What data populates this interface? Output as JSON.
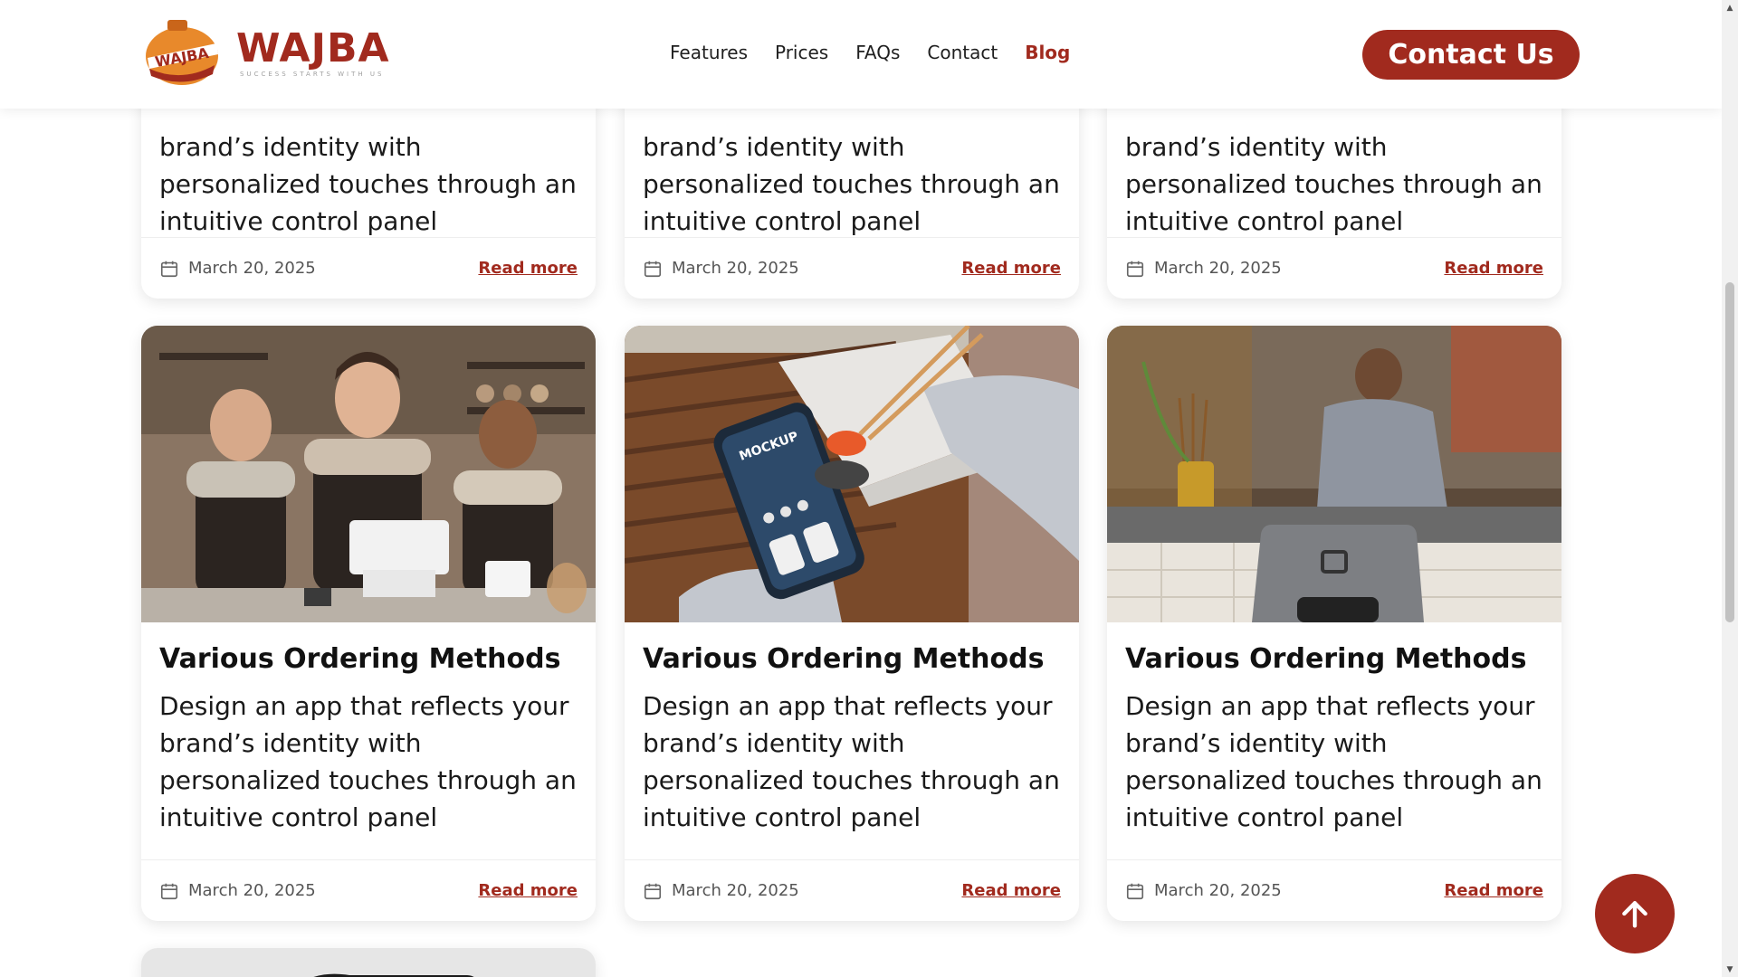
{
  "header": {
    "logo_badge_text": "WAJBA",
    "logo_word": "WAJBA",
    "logo_tagline": "SUCCESS STARTS WITH US",
    "nav": [
      {
        "label": "Features",
        "active": false
      },
      {
        "label": "Prices",
        "active": false
      },
      {
        "label": "FAQs",
        "active": false
      },
      {
        "label": "Contact",
        "active": false
      },
      {
        "label": "Blog",
        "active": true
      }
    ],
    "contact_button": "Contact Us"
  },
  "colors": {
    "brand": "#a12a1e",
    "accent_orange": "#e8892b"
  },
  "top_cards": [
    {
      "desc_line1": "brand’s identity with",
      "desc_line2": "personalized touches through an",
      "desc_line3": "intuitive control panel",
      "date": "March 20, 2025",
      "read_more": "Read more"
    },
    {
      "desc_line1": "brand’s identity with",
      "desc_line2": "personalized touches through an",
      "desc_line3": "intuitive control panel",
      "date": "March 20, 2025",
      "read_more": "Read more"
    },
    {
      "desc_line1": "brand’s identity with",
      "desc_line2": "personalized touches through an",
      "desc_line3": "intuitive control panel",
      "date": "March 20, 2025",
      "read_more": "Read more"
    }
  ],
  "cards": [
    {
      "image": "baristas-at-counter",
      "title": "Various Ordering Methods",
      "desc_line1": "Design an app that reflects your",
      "desc_line2": "brand’s identity with",
      "desc_line3": "personalized touches through an",
      "desc_line4": "intuitive control panel",
      "date": "March 20, 2025",
      "read_more": "Read more"
    },
    {
      "image": "phone-ordering-app-mockup",
      "title": "Various Ordering Methods",
      "desc_line1": "Design an app that reflects your",
      "desc_line2": "brand’s identity with",
      "desc_line3": "personalized touches through an",
      "desc_line4": "intuitive control panel",
      "date": "March 20, 2025",
      "read_more": "Read more"
    },
    {
      "image": "pos-tablet-in-cafe",
      "title": "Various Ordering Methods",
      "desc_line1": "Design an app that reflects your",
      "desc_line2": "brand’s identity with",
      "desc_line3": "personalized touches through an",
      "desc_line4": "intuitive control panel",
      "date": "March 20, 2025",
      "read_more": "Read more"
    }
  ],
  "scroll_top_icon": "arrow-up-icon"
}
